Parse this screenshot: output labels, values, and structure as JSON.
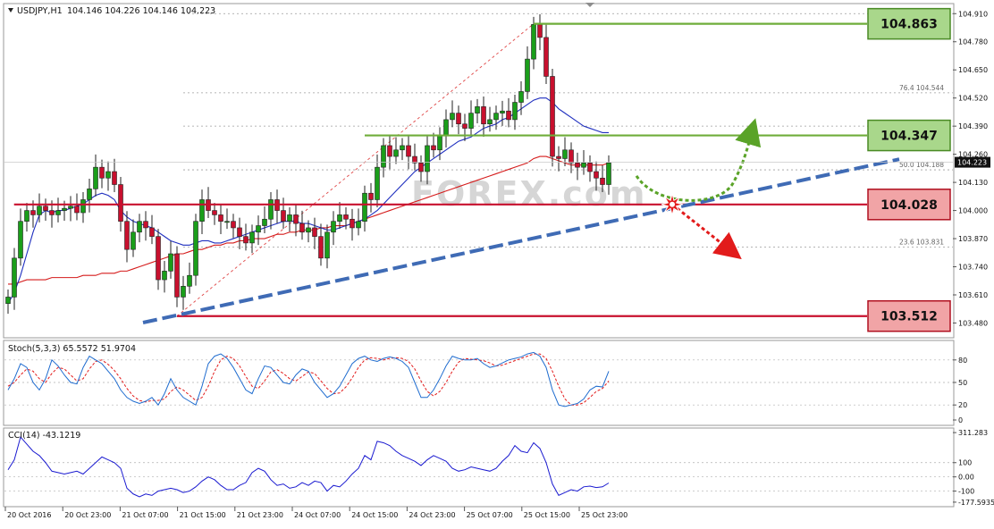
{
  "header": {
    "symbol": "USDJPY,H1",
    "ohlc": "104.146 104.226 104.146 104.223"
  },
  "watermark": "FOREX.com",
  "colors": {
    "bull": "#1a9e1a",
    "bear": "#c8102e",
    "sma_blue": "#1f2fbf",
    "sma_red": "#d51b1b",
    "trend": "#3f6bb5",
    "green_level": "#6fad3a",
    "red_level": "#c8102e",
    "green_box": "#a9d78b",
    "red_box": "#f1a4a6"
  },
  "chart_data": [
    {
      "type": "candlestick",
      "name": "main",
      "ylim": [
        103.42,
        104.94
      ],
      "y_ticks": [
        "104.910",
        "104.780",
        "104.650",
        "104.520",
        "104.390",
        "104.260",
        "104.130",
        "104.000",
        "103.870",
        "103.740",
        "103.610",
        "103.480"
      ],
      "current_price": "104.223",
      "x_tick_labels": [
        "20 Oct 2016",
        "20 Oct 23:00",
        "21 Oct 07:00",
        "21 Oct 15:00",
        "21 Oct 23:00",
        "24 Oct 07:00",
        "24 Oct 15:00",
        "24 Oct 23:00",
        "25 Oct 07:00",
        "25 Oct 15:00",
        "25 Oct 23:00"
      ],
      "fibonacci": [
        {
          "label": "76.4",
          "value": "104.544"
        },
        {
          "label": "50.0",
          "value": "104.188"
        },
        {
          "label": "23.6",
          "value": "103.831"
        }
      ],
      "levels": [
        {
          "value": "104.863",
          "kind": "resistance"
        },
        {
          "value": "104.347",
          "kind": "resistance"
        },
        {
          "value": "104.028",
          "kind": "support"
        },
        {
          "value": "103.512",
          "kind": "support"
        }
      ],
      "closes": [
        103.6,
        103.78,
        103.95,
        104.0,
        103.98,
        104.02,
        104.0,
        103.98,
        104.0,
        104.01,
        104.02,
        103.99,
        104.05,
        104.1,
        104.2,
        104.15,
        104.18,
        104.12,
        103.95,
        103.82,
        103.9,
        103.95,
        103.92,
        103.88,
        103.68,
        103.72,
        103.8,
        103.6,
        103.65,
        103.7,
        103.95,
        104.05,
        104.0,
        103.98,
        103.95,
        103.95,
        103.92,
        103.88,
        103.85,
        103.9,
        103.93,
        103.96,
        104.05,
        104.0,
        103.95,
        103.98,
        103.94,
        103.9,
        103.92,
        103.88,
        103.78,
        103.9,
        103.95,
        103.98,
        103.96,
        103.92,
        103.95,
        104.08,
        104.05,
        104.2,
        104.3,
        104.25,
        104.28,
        104.3,
        104.25,
        104.22,
        104.18,
        104.3,
        104.28,
        104.35,
        104.42,
        104.45,
        104.4,
        104.38,
        104.45,
        104.48,
        104.4,
        104.42,
        104.45,
        104.46,
        104.42,
        104.5,
        104.55,
        104.7,
        104.86,
        104.8,
        104.62,
        104.25,
        104.24,
        104.28,
        104.22,
        104.2,
        104.22,
        104.18,
        104.15,
        104.12,
        104.22
      ],
      "sma_blue": [
        103.57,
        103.62,
        103.7,
        103.8,
        103.9,
        103.98,
        104.0,
        103.99,
        104.0,
        104.0,
        104.01,
        104.02,
        104.03,
        104.05,
        104.07,
        104.08,
        104.07,
        104.05,
        104.0,
        103.97,
        103.95,
        103.94,
        103.93,
        103.92,
        103.9,
        103.88,
        103.86,
        103.85,
        103.84,
        103.84,
        103.85,
        103.86,
        103.86,
        103.85,
        103.85,
        103.86,
        103.87,
        103.88,
        103.89,
        103.9,
        103.91,
        103.92,
        103.93,
        103.94,
        103.95,
        103.95,
        103.95,
        103.94,
        103.94,
        103.93,
        103.92,
        103.91,
        103.91,
        103.92,
        103.93,
        103.94,
        103.95,
        103.96,
        103.98,
        104.0,
        104.03,
        104.06,
        104.09,
        104.12,
        104.15,
        104.18,
        104.2,
        104.22,
        104.24,
        104.26,
        104.28,
        104.3,
        104.32,
        104.33,
        104.34,
        104.36,
        104.38,
        104.39,
        104.4,
        104.42,
        104.43,
        104.45,
        104.47,
        104.49,
        104.51,
        104.52,
        104.52,
        104.5,
        104.47,
        104.45,
        104.43,
        104.41,
        104.39,
        104.38,
        104.37,
        104.36,
        104.36
      ],
      "sma_red": [
        103.66,
        103.66,
        103.67,
        103.68,
        103.68,
        103.68,
        103.68,
        103.69,
        103.69,
        103.69,
        103.69,
        103.69,
        103.7,
        103.7,
        103.7,
        103.71,
        103.71,
        103.71,
        103.72,
        103.72,
        103.73,
        103.74,
        103.75,
        103.76,
        103.77,
        103.78,
        103.79,
        103.8,
        103.8,
        103.81,
        103.82,
        103.82,
        103.83,
        103.84,
        103.84,
        103.85,
        103.85,
        103.86,
        103.86,
        103.87,
        103.87,
        103.87,
        103.88,
        103.89,
        103.89,
        103.9,
        103.9,
        103.91,
        103.91,
        103.91,
        103.92,
        103.92,
        103.93,
        103.93,
        103.93,
        103.94,
        103.95,
        103.96,
        103.97,
        103.98,
        103.99,
        104.0,
        104.01,
        104.02,
        104.03,
        104.04,
        104.05,
        104.06,
        104.07,
        104.08,
        104.09,
        104.1,
        104.11,
        104.12,
        104.13,
        104.14,
        104.15,
        104.16,
        104.17,
        104.18,
        104.19,
        104.2,
        104.21,
        104.22,
        104.24,
        104.25,
        104.25,
        104.24,
        104.23,
        104.22,
        104.21,
        104.21,
        104.21,
        104.21,
        104.21,
        104.21,
        104.22
      ]
    },
    {
      "type": "line",
      "name": "stochastic",
      "title": "Stoch(5,3,3) 65.5572 51.9704",
      "ylim": [
        0,
        100
      ],
      "y_ticks": [
        "80",
        "50",
        "20",
        "0"
      ],
      "main_line": [
        40,
        55,
        75,
        70,
        50,
        40,
        55,
        80,
        72,
        60,
        50,
        48,
        70,
        85,
        80,
        75,
        65,
        55,
        40,
        30,
        25,
        22,
        25,
        30,
        20,
        35,
        55,
        40,
        30,
        25,
        20,
        45,
        75,
        85,
        88,
        82,
        70,
        55,
        40,
        35,
        55,
        72,
        70,
        60,
        50,
        48,
        60,
        68,
        65,
        50,
        40,
        30,
        35,
        45,
        60,
        75,
        82,
        85,
        80,
        78,
        82,
        84,
        82,
        78,
        70,
        50,
        30,
        30,
        40,
        55,
        72,
        85,
        82,
        80,
        80,
        82,
        75,
        70,
        72,
        76,
        80,
        82,
        84,
        88,
        90,
        85,
        70,
        40,
        20,
        18,
        20,
        22,
        28,
        40,
        45,
        44,
        65
      ],
      "signal_line": [
        45,
        50,
        60,
        68,
        65,
        55,
        50,
        62,
        70,
        68,
        60,
        52,
        55,
        68,
        78,
        80,
        74,
        66,
        55,
        42,
        32,
        26,
        24,
        26,
        26,
        28,
        38,
        44,
        40,
        33,
        26,
        30,
        45,
        65,
        80,
        85,
        82,
        72,
        58,
        45,
        42,
        52,
        64,
        67,
        62,
        55,
        52,
        58,
        64,
        62,
        52,
        42,
        35,
        36,
        44,
        56,
        70,
        80,
        83,
        82,
        80,
        82,
        83,
        82,
        78,
        68,
        52,
        38,
        32,
        38,
        50,
        65,
        77,
        82,
        81,
        80,
        79,
        76,
        72,
        73,
        76,
        79,
        82,
        85,
        88,
        88,
        82,
        65,
        45,
        28,
        20,
        20,
        23,
        30,
        38,
        42,
        52
      ]
    },
    {
      "type": "line",
      "name": "cci",
      "title": "CCI(14) -43.1219",
      "ylim": [
        -178,
        312
      ],
      "y_ticks": [
        "311.283",
        "100",
        "0.00",
        "-100",
        "-177.59359"
      ],
      "values": [
        50,
        120,
        280,
        230,
        180,
        150,
        100,
        40,
        30,
        20,
        30,
        40,
        20,
        60,
        100,
        140,
        120,
        100,
        60,
        -80,
        -120,
        -140,
        -120,
        -130,
        -100,
        -90,
        -80,
        -90,
        -110,
        -100,
        -70,
        -30,
        0,
        -20,
        -60,
        -90,
        -90,
        -60,
        -40,
        30,
        60,
        40,
        -20,
        -60,
        -50,
        -80,
        -70,
        -40,
        -60,
        -30,
        -40,
        -100,
        -60,
        -70,
        -30,
        20,
        60,
        150,
        120,
        250,
        240,
        220,
        180,
        150,
        130,
        110,
        80,
        120,
        150,
        130,
        110,
        60,
        40,
        50,
        70,
        60,
        50,
        40,
        60,
        110,
        150,
        220,
        180,
        170,
        240,
        200,
        100,
        -50,
        -130,
        -110,
        -90,
        -100,
        -70,
        -65,
        -75,
        -70,
        -43
      ]
    }
  ]
}
